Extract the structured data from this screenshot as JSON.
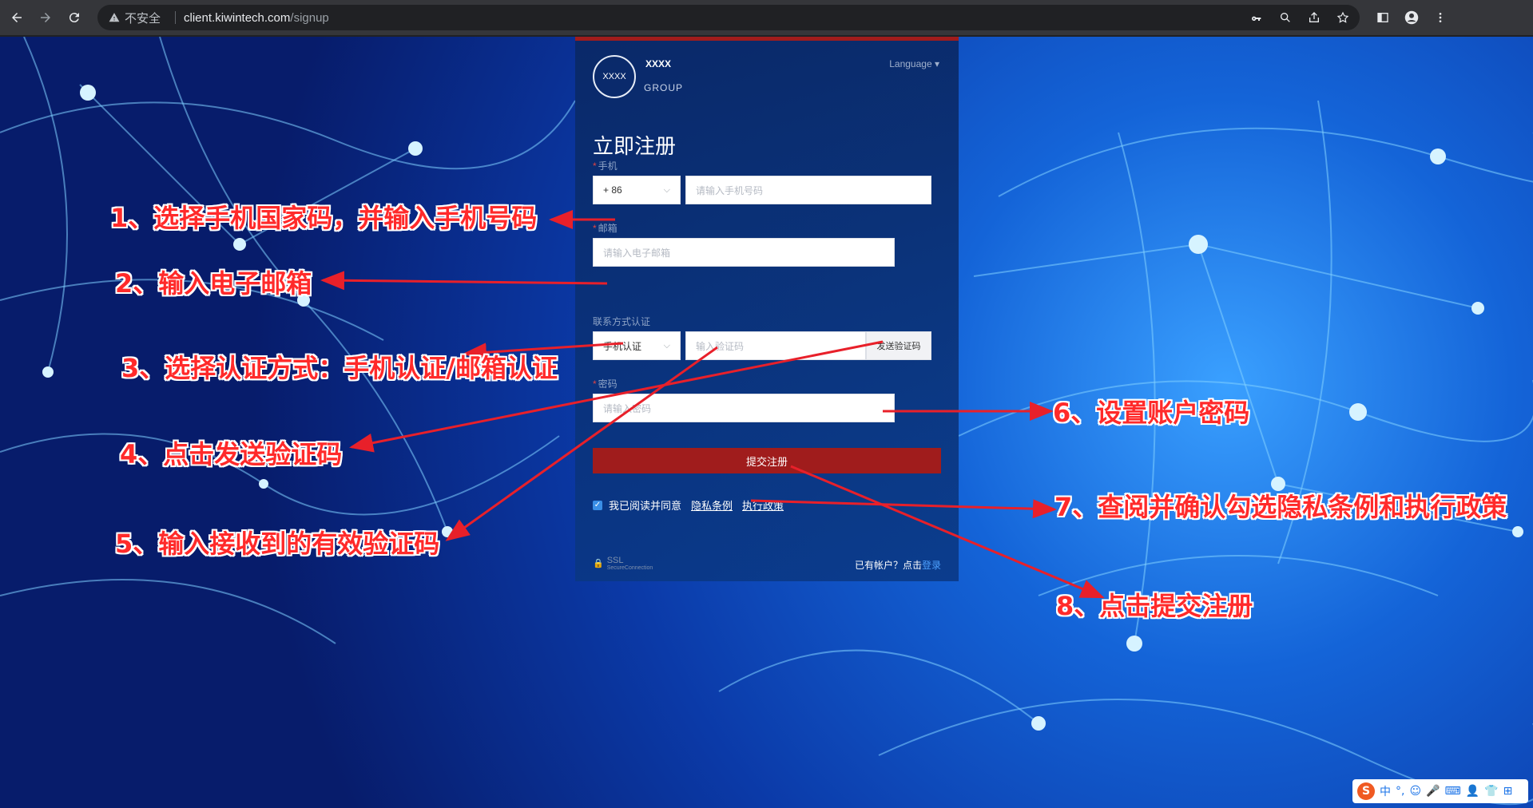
{
  "browser": {
    "security_label": "不安全",
    "url_host": "client.kiwintech.com",
    "url_path": "/signup"
  },
  "panel": {
    "logo_text": "XXXX",
    "brand_name": "XXXX",
    "brand_sub": "GROUP",
    "language": "Language",
    "title": "立即注册",
    "phone_label": "手机",
    "country_code": "+ 86",
    "phone_placeholder": "请输入手机号码",
    "email_label": "邮箱",
    "email_placeholder": "请输入电子邮箱",
    "verify_label": "联系方式认证",
    "verify_method": "手机认证",
    "code_placeholder": "输入验证码",
    "send_code": "发送验证码",
    "password_label": "密码",
    "password_placeholder": "请输入密码",
    "submit": "提交注册",
    "agree_text": "我已阅读并同意",
    "privacy_link": "隐私条例",
    "policy_link": "执行政策",
    "ssl_text": "SSL",
    "ssl_sub": "SecureConnection",
    "have_account": "已有帐户？点击",
    "login_link": "登录"
  },
  "annotations": [
    "1、选择手机国家码，并输入手机号码",
    "2、输入电子邮箱",
    "3、选择认证方式：手机认证/邮箱认证",
    "4、点击发送验证码",
    "5、输入接收到的有效验证码",
    "6、设置账户密码",
    "7、查阅并确认勾选隐私条例和执行政策",
    "8、点击提交注册"
  ],
  "ime": {
    "lang": "中"
  },
  "colors": {
    "accent_red": "#a01c1c",
    "annotation_red": "#ff2a2a",
    "link_blue": "#4ea2ff"
  }
}
